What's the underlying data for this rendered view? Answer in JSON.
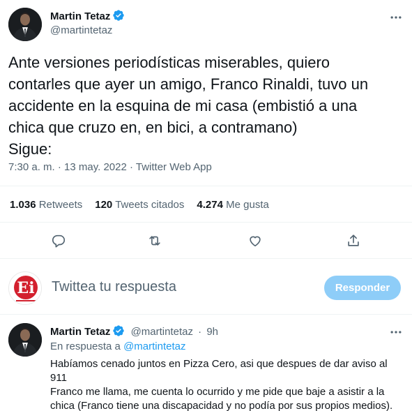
{
  "main_tweet": {
    "author_name": "Martin Tetaz",
    "author_handle": "@martintetaz",
    "text": "Ante versiones periodísticas miserables, quiero\ncontarles que ayer un amigo, Franco Rinaldi, tuvo un\naccidente en la esquina de mi casa (embistió a una\nchica que cruzo en, en bici, a contramano)\nSigue:",
    "meta": "7:30 a. m. · 13 may. 2022 · Twitter Web App"
  },
  "stats": {
    "retweets_count": "1.036",
    "retweets_label": "Retweets",
    "quotes_count": "120",
    "quotes_label": "Tweets citados",
    "likes_count": "4.274",
    "likes_label": "Me gusta"
  },
  "actions": [
    "reply-icon",
    "retweet-icon",
    "like-icon",
    "share-icon"
  ],
  "composer": {
    "avatar_text": "Ei",
    "placeholder": "Twittea tu respuesta",
    "button_label": "Responder"
  },
  "reply_tweet": {
    "author_name": "Martin Tetaz",
    "author_handle": "@martintetaz",
    "separator": "·",
    "time": "9h",
    "in_reply_prefix": "En respuesta a",
    "in_reply_handle": "@martintetaz",
    "text": "Habíamos cenado juntos en Pizza Cero, asi que despues de dar aviso al 911\nFranco me llama, me cuenta lo ocurrido y me pide que baje a asistir a la\nchica (Franco tiene una discapacidad y no podía por sus propios medios).\nCuando llegue ya estaba la policía controlando la escena"
  },
  "colors": {
    "accent": "#1d9bf0",
    "button_disabled": "#8ecdf8",
    "secondary_text": "#536471",
    "logo_red": "#d3202e"
  }
}
